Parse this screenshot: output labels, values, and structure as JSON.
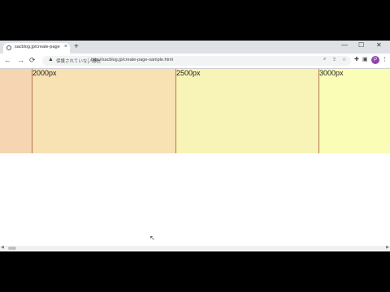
{
  "tab": {
    "title": "sacblog.jp/create-page-sample",
    "close": "×"
  },
  "newtab": "+",
  "window": {
    "minimize": "—",
    "maximize": "☐",
    "close": "✕"
  },
  "nav": {
    "back": "←",
    "forward": "→",
    "reload": "⟳"
  },
  "omnibox": {
    "security": "保護されていない通信",
    "url": "http://sacblog.jp/create-page-sample.html"
  },
  "profile": {
    "initial": "P",
    "color": "#8e44ad"
  },
  "bands": [
    {
      "label": ""
    },
    {
      "label": "2000px"
    },
    {
      "label": "2500px"
    },
    {
      "label": "3000px"
    }
  ],
  "colors": {
    "band0": "#f6d5b2",
    "band1": "#f8e1b2",
    "band2": "#f8f3b6",
    "band3": "#fafdb6",
    "divider": "#b07850"
  }
}
